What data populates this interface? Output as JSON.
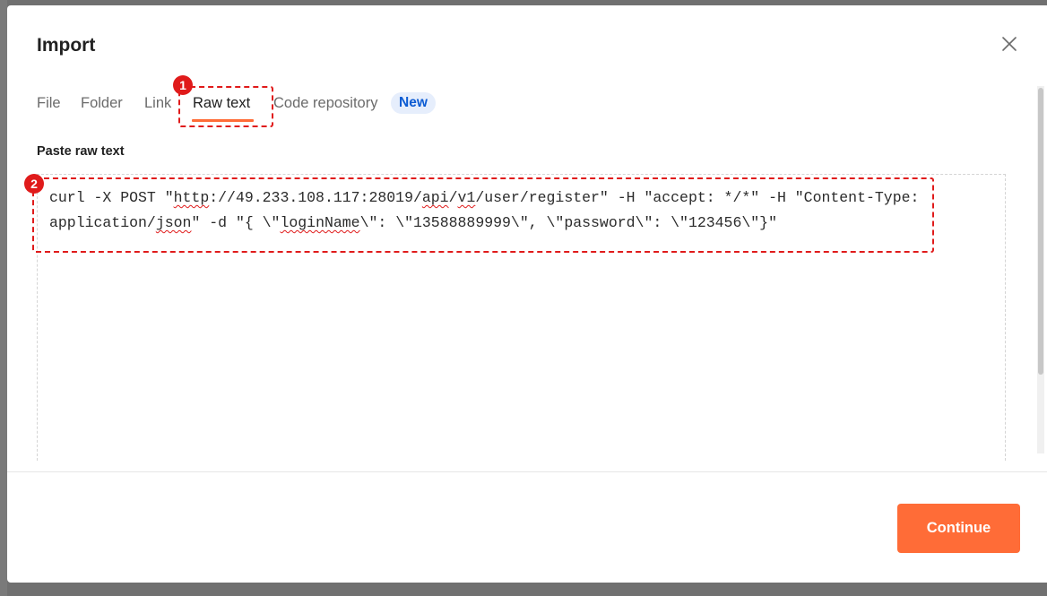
{
  "dialog": {
    "title": "Import"
  },
  "tabs": [
    {
      "label": "File",
      "active": false
    },
    {
      "label": "Folder",
      "active": false
    },
    {
      "label": "Link",
      "active": false
    },
    {
      "label": "Raw text",
      "active": true
    },
    {
      "label": "Code repository",
      "active": false
    }
  ],
  "new_badge": "New",
  "annotations": [
    "1",
    "2"
  ],
  "raw_text": {
    "label": "Paste raw text",
    "segments": [
      {
        "text": "curl -X POST \"",
        "flag": false
      },
      {
        "text": "http",
        "flag": true
      },
      {
        "text": "://49.233.108.117:28019/",
        "flag": false
      },
      {
        "text": "api",
        "flag": true
      },
      {
        "text": "/",
        "flag": false
      },
      {
        "text": "v1",
        "flag": true
      },
      {
        "text": "/user/register\" -H \"accept: */*\" -H \"Content-Type: application/",
        "flag": false
      },
      {
        "text": "json",
        "flag": true
      },
      {
        "text": "\" -d \"{ \\\"",
        "flag": false
      },
      {
        "text": "loginName",
        "flag": true
      },
      {
        "text": "\\\": \\\"13588889999\\\", \\\"password\\\": \\\"123456\\\"}\"",
        "flag": false
      }
    ]
  },
  "footer": {
    "continue_label": "Continue"
  },
  "colors": {
    "accent": "#ff6c37",
    "annotation": "#e01b1b",
    "badge_bg": "#e6eefc",
    "badge_text": "#0b5bd3"
  },
  "icons": {
    "close": "close-icon"
  }
}
